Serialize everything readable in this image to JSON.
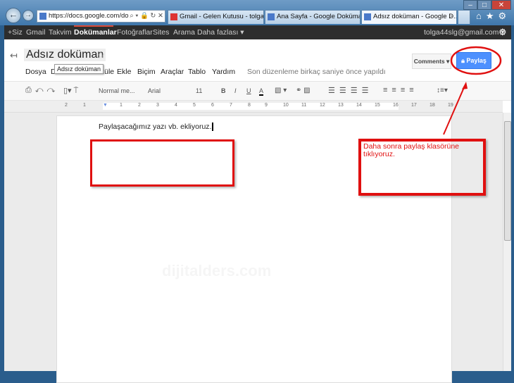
{
  "browser": {
    "url": "https://docs.google.com/do",
    "tabs": [
      {
        "label": "Gmail - Gelen Kutusu - tolga44...",
        "icon": "gmail-icon"
      },
      {
        "label": "Ana Sayfa - Google Dokümanl...",
        "icon": "docs-home-icon"
      },
      {
        "label": "Adsız doküman - Google D...",
        "icon": "docs-icon",
        "active": true
      }
    ],
    "close_tab": "×",
    "window_controls": [
      "–",
      "□",
      "✕"
    ]
  },
  "gbar": {
    "items": [
      "+Siz",
      "Gmail",
      "Takvim",
      "Dokümanlar",
      "Fotoğraflar",
      "Sites",
      "Arama",
      "Daha fazlası ▾"
    ],
    "selected": "Dokümanlar",
    "account": "tolga44slg@gmail.com ▾"
  },
  "doc": {
    "title": "Adsız doküman",
    "tooltip": "Adsız doküman",
    "menu": [
      "Dosya",
      "D",
      "Görüntüle",
      "Ekle",
      "Biçim",
      "Araçlar",
      "Tablo",
      "Yardım"
    ],
    "status": "Son düzenleme birkaç saniye önce yapıldı",
    "comments_label": "Comments ▾",
    "share_label": "Paylaş",
    "body_text": "Paylaşacağımız yazı vb. ekliyoruz."
  },
  "toolbar": {
    "style": "Normal me...",
    "font": "Arial",
    "size": "11",
    "bold": "B",
    "italic": "I",
    "underline": "U",
    "text_color": "A"
  },
  "ruler": [
    "2",
    "1",
    "1",
    "2",
    "3",
    "4",
    "5",
    "6",
    "7",
    "8",
    "9",
    "10",
    "11",
    "12",
    "13",
    "14",
    "15",
    "16",
    "17",
    "18",
    "19"
  ],
  "annotation": {
    "note": "Daha sonra paylaş klasörüne tıklıyoruz.",
    "color": "#e01010"
  },
  "watermark": "dijitalders.com"
}
